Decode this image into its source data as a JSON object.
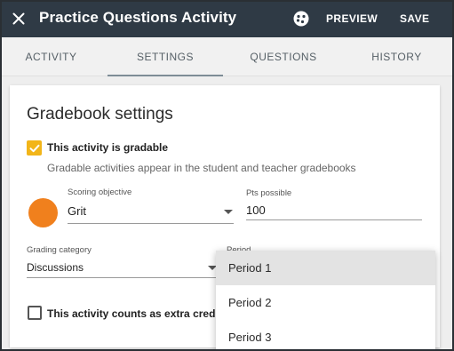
{
  "appbar": {
    "title": "Practice Questions Activity",
    "preview_label": "PREVIEW",
    "save_label": "SAVE",
    "background": "#2f3a45"
  },
  "tabs": [
    {
      "label": "ACTIVITY",
      "active": false
    },
    {
      "label": "SETTINGS",
      "active": true
    },
    {
      "label": "QUESTIONS",
      "active": false
    },
    {
      "label": "HISTORY",
      "active": false
    }
  ],
  "gradebook": {
    "title": "Gradebook settings",
    "gradable": {
      "checked": true,
      "label": "This activity is gradable",
      "help": "Gradable activities appear in the student and teacher gradebooks",
      "accent": "#f2b519"
    },
    "scoring_objective": {
      "label": "Scoring objective",
      "value": "Grit",
      "color": "#f0801d"
    },
    "points": {
      "label": "Pts possible",
      "value": "100"
    },
    "grading_category": {
      "label": "Grading category",
      "value": "Discussions"
    },
    "period": {
      "label": "Period",
      "options": [
        "Period 1",
        "Period 2",
        "Period 3"
      ],
      "highlighted": "Period 1"
    },
    "extra_credit": {
      "checked": false,
      "label": "This activity counts as extra credit"
    }
  }
}
